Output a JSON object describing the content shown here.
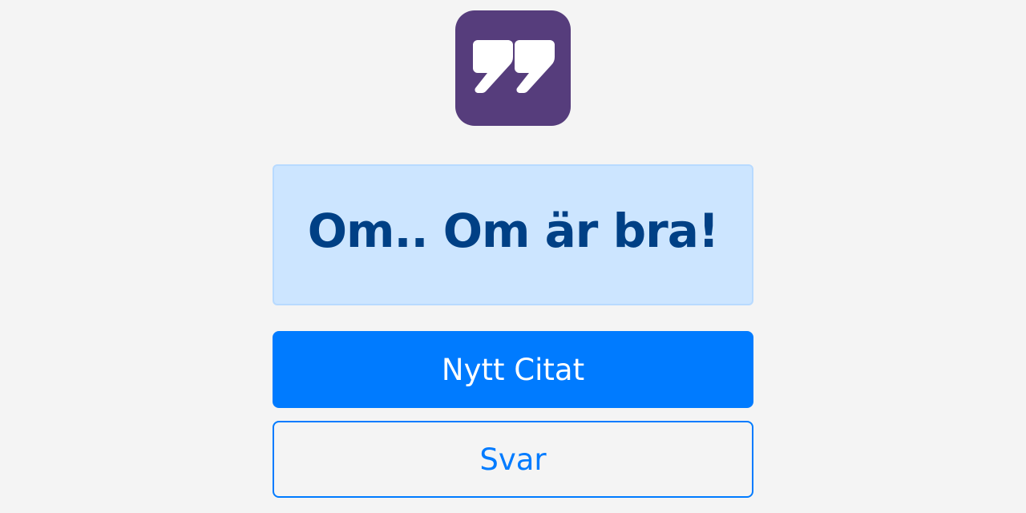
{
  "logo": {
    "icon": "quote-icon",
    "color": "#563d7c"
  },
  "quote": {
    "text": "Om.. Om är bra!",
    "text_color": "#004085",
    "background": "#cce5ff"
  },
  "buttons": {
    "new_quote_label": "Nytt Citat",
    "answer_label": "Svar",
    "primary_color": "#007bff"
  }
}
